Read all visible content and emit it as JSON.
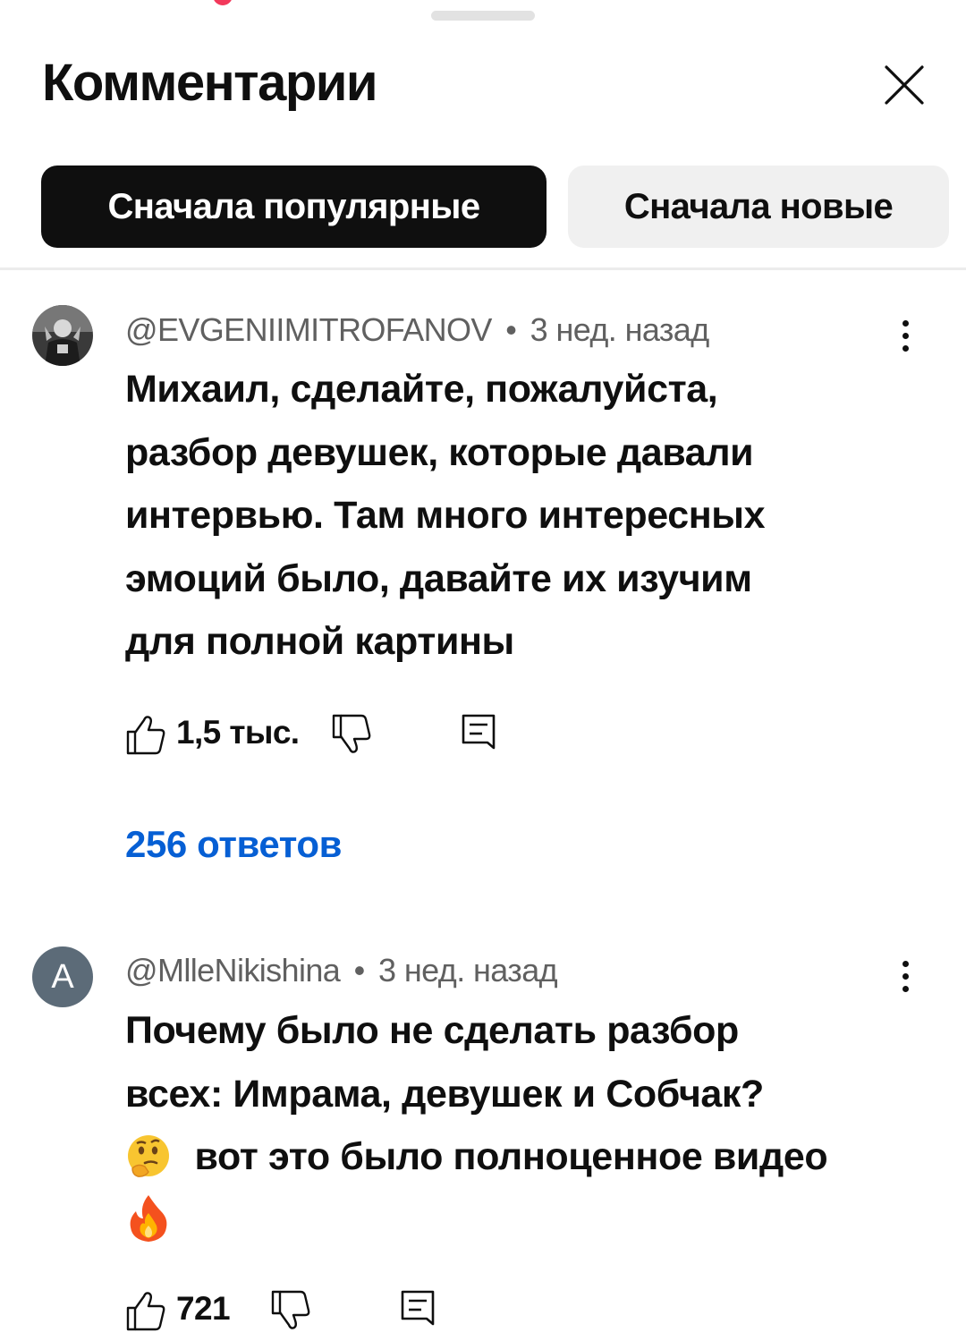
{
  "sheet": {
    "title": "Комментарии",
    "close_icon": "close-icon"
  },
  "sort_chips": [
    {
      "label": "Сначала популярные",
      "active": true
    },
    {
      "label": "Сначала новые",
      "active": false
    }
  ],
  "comments": [
    {
      "author": "@EVGENIIMITROFANOV",
      "separator": "•",
      "time": "3 нед. назад",
      "avatar": "photo",
      "lines": [
        "Михаил, сделайте, пожалуйста,",
        "разбор девушек, которые давали",
        "интервью. Там много интересных",
        "эмоций было, давайте их изучим",
        "для полной картины"
      ],
      "likes": "1,5 тыс.",
      "replies_label": "256 ответов"
    },
    {
      "author": "@MlleNikishina",
      "separator": "•",
      "time": "3 нед. назад",
      "avatar": "letter",
      "avatar_letter": "A",
      "lines": [
        "Почему было не сделать разбор",
        "всех: Имрама, девушек и Собчак?",
        "вот это было полноценное видео"
      ],
      "emojis": [
        "thinking-face-emoji",
        "fire-emoji"
      ],
      "likes": "721"
    }
  ],
  "colors": {
    "link": "#065fd4",
    "secondary_text": "#606060",
    "chip_active": "#0f0f0f",
    "chip_idle": "#f0f0f0",
    "avatar_letter_bg": "#5c6b78"
  }
}
